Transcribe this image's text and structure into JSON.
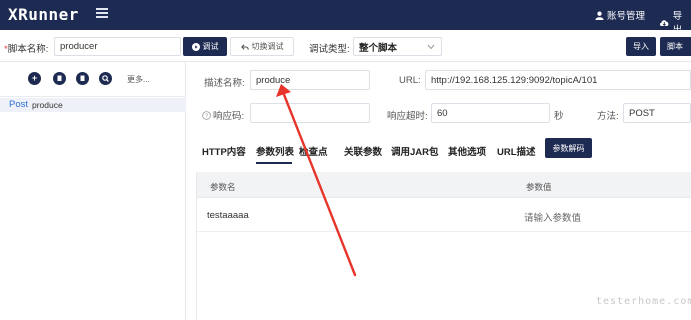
{
  "header": {
    "logo": "XRunner",
    "account_label": "账号管理",
    "export_label": "导出"
  },
  "toolbar": {
    "script_name_label": "脚本名称:",
    "script_name_value": "producer",
    "debug_button": "调试",
    "switch_debug_button": "切换调试",
    "debug_type_label": "调试类型:",
    "debug_type_value": "整个脚本",
    "import_button": "导入",
    "script_button": "脚本"
  },
  "sidebar": {
    "more_label": "更多...",
    "tree": [
      {
        "method": "Post",
        "name": "produce"
      }
    ]
  },
  "form": {
    "desc_label": "描述名称:",
    "desc_value": "produce",
    "url_label": "URL:",
    "url_value": "http://192.168.125.129:9092/topicA/101",
    "response_code_label": "响应码:",
    "response_code_value": "",
    "timeout_label": "响应超时:",
    "timeout_value": "60",
    "timeout_unit": "秒",
    "method_label": "方法:",
    "method_value": "POST"
  },
  "tabs": {
    "items": [
      "HTTP内容",
      "参数列表",
      "检查点",
      "关联参数",
      "调用JAR包",
      "其他选项",
      "URL描述"
    ],
    "active": "参数列表",
    "decode_button": "参数解码"
  },
  "table": {
    "headers": [
      "参数名",
      "参数值"
    ],
    "rows": [
      {
        "name": "testaaaaa",
        "value_placeholder": "请输入参数值"
      }
    ]
  },
  "watermark": "testerhome.com",
  "colors": {
    "navy": "#1d2a52",
    "annotation_arrow": "#e8352b",
    "tree_method": "#2f6fd6"
  }
}
